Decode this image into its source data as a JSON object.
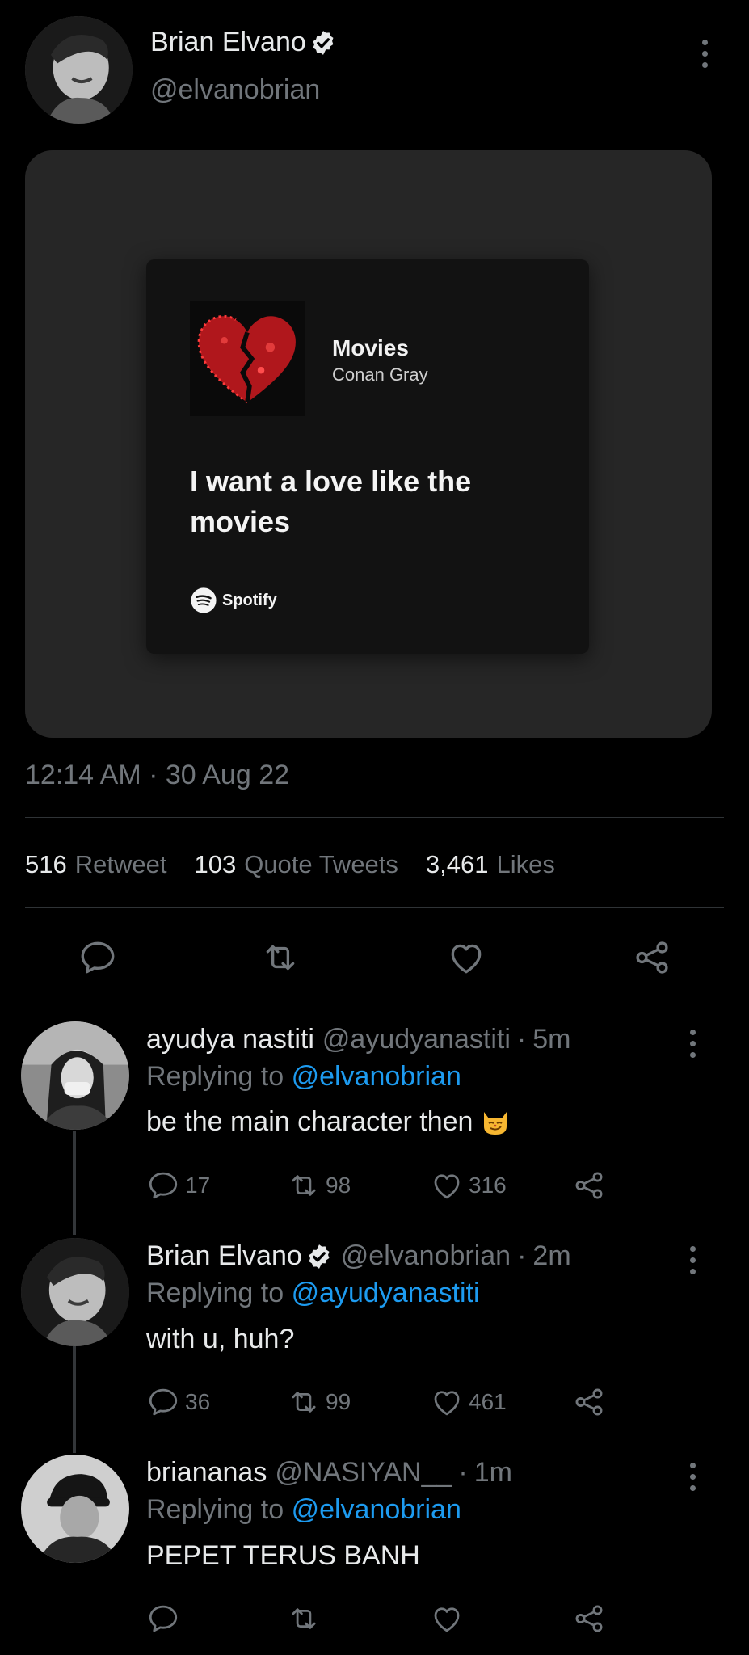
{
  "tweet": {
    "author_name": "Brian Elvano",
    "author_handle": "@elvanobrian",
    "timestamp": "12:14 AM · 30 Aug 22",
    "media": {
      "song_title": "Movies",
      "artist": "Conan Gray",
      "lyric": "I want a love like the movies",
      "brand": "Spotify"
    },
    "stats": {
      "retweets_count": "516",
      "retweets_label": "Retweet",
      "quotes_count": "103",
      "quotes_label": "Quote Tweets",
      "likes_count": "3,461",
      "likes_label": "Likes"
    },
    "icons": {
      "reply": "reply-icon",
      "retweet": "retweet-icon",
      "like": "heart-icon",
      "share": "share-icon",
      "verified": "verified-badge-icon",
      "more": "more-options-icon"
    }
  },
  "replies": [
    {
      "name": "ayudya nastiti",
      "handle": "@ayudyanastiti",
      "time": "5m",
      "replying_prefix": "Replying to",
      "replying_to": "@elvanobrian",
      "text": "be the main character then",
      "emoji": "smirking-cat-emoji",
      "reply_count": "17",
      "retweet_count": "98",
      "like_count": "316"
    },
    {
      "name": "Brian Elvano",
      "handle": "@elvanobrian",
      "time": "2m",
      "replying_prefix": "Replying to",
      "replying_to": "@ayudyanastiti",
      "text": "with u, huh?",
      "reply_count": "36",
      "retweet_count": "99",
      "like_count": "461"
    },
    {
      "name": "briananas",
      "handle": "@NASIYAN__",
      "time": "1m",
      "replying_prefix": "Replying to",
      "replying_to": "@elvanobrian",
      "text": "PEPET TERUS BANH"
    }
  ],
  "colors": {
    "background": "#000000",
    "text_primary": "#e7e9ea",
    "text_secondary": "#71767b",
    "link": "#1d9bf0",
    "divider": "#2f3336",
    "media_bg": "#262626",
    "card_bg": "#121212"
  }
}
